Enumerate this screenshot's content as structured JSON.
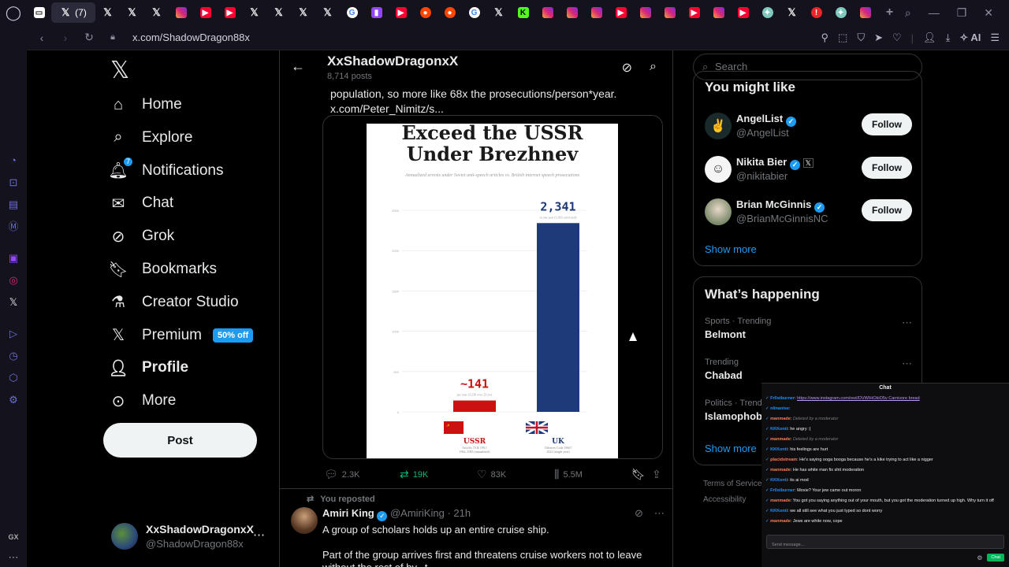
{
  "browser": {
    "active_tab_label": "(7)",
    "tabs": [
      "x",
      "x",
      "x",
      "ig",
      "yt",
      "yt",
      "x",
      "x",
      "x",
      "x",
      "gg",
      "tw",
      "yt",
      "rd",
      "rd",
      "gg",
      "x",
      "kk",
      "ig",
      "ig",
      "ig",
      "yt",
      "ig",
      "ig",
      "yt",
      "ig",
      "yt",
      "cf",
      "x",
      "rd2",
      "cf",
      "ig"
    ],
    "url": "x.com/ShadowDragon88x",
    "ai_label": "AI",
    "sidebar_bottom_label": "GX"
  },
  "nav": {
    "items": [
      {
        "label": "Home",
        "icon": "home-icon"
      },
      {
        "label": "Explore",
        "icon": "search-icon"
      },
      {
        "label": "Notifications",
        "icon": "bell-icon",
        "badge": "7"
      },
      {
        "label": "Chat",
        "icon": "mail-icon"
      },
      {
        "label": "Grok",
        "icon": "grok-icon"
      },
      {
        "label": "Bookmarks",
        "icon": "bookmark-icon"
      },
      {
        "label": "Creator Studio",
        "icon": "flask-icon"
      },
      {
        "label": "Premium",
        "icon": "x-icon",
        "badge": "50% off"
      },
      {
        "label": "Profile",
        "icon": "person-icon"
      },
      {
        "label": "More",
        "icon": "more-circle-icon"
      }
    ],
    "post_label": "Post",
    "account": {
      "name": "XxShadowDragonxX",
      "handle": "@ShadowDragon88x"
    }
  },
  "profile_header": {
    "name": "XxShadowDragonxX",
    "posts": "8,714 posts"
  },
  "tweet1": {
    "text_line1": "population, so more like 68x the prosecutions/person*year.",
    "text_line2": "x.com/Peter_Nimitz/s...",
    "chart_title_line1": "Exceed the USSR",
    "chart_title_line2": "Under Brezhnev",
    "chart_subtitle": "Annualized arrests under Soviet anti-speech articles vs. British internet speech prosecutions",
    "stats": {
      "replies": "2.3K",
      "reposts": "19K",
      "likes": "83K",
      "views": "5.5M"
    }
  },
  "chart_data": {
    "type": "bar",
    "title": "Exceed the USSR Under Brezhnev",
    "subtitle": "Annualized arrests under Soviet anti-speech articles vs. British internet speech prosecutions",
    "categories": [
      "USSR",
      "UK"
    ],
    "values": [
      141,
      2341
    ],
    "value_labels": [
      "~141",
      "2,341"
    ],
    "value_captions": [
      "per year (3,238 over 23 yrs)",
      "in one year (1,016 convicted)"
    ],
    "category_captions": [
      [
        "Articles 70 & 190.1",
        "1962–1985 (annualized)"
      ],
      [
        "Offences Code 19667",
        "2022 (single year)"
      ]
    ],
    "yticks": [
      0,
      500,
      1000,
      1500,
      2000,
      2500
    ],
    "ylim": [
      0,
      2500
    ],
    "colors": [
      "#cc1111",
      "#1f3a78"
    ],
    "grid": true
  },
  "tweet2": {
    "repost_label": "You reposted",
    "name": "Amiri King",
    "handle": "@AmiriKing",
    "time": "21h",
    "text1": "A group of scholars holds up an entire cruise ship.",
    "text2": "Part of the group arrives first and threatens cruise workers not to leave",
    "text3": "without the rest of by...t..."
  },
  "right": {
    "search_placeholder": "Search",
    "wtf_title": "You might like",
    "wtf": [
      {
        "name": "AngelList",
        "handle": "@AngelList",
        "follow": "Follow"
      },
      {
        "name": "Nikita Bier",
        "handle": "@nikitabier",
        "follow": "Follow"
      },
      {
        "name": "Brian McGinnis",
        "handle": "@BrianMcGinnisNC",
        "follow": "Follow"
      }
    ],
    "show_more": "Show more",
    "happening_title": "What’s happening",
    "trends": [
      {
        "category": "Sports · Trending",
        "name": "Belmont"
      },
      {
        "category": "Trending",
        "name": "Chabad"
      },
      {
        "category": "Politics · Trend",
        "name": "Islamophobi"
      }
    ],
    "show_more2": "Show more",
    "footer1": "Terms of Service",
    "footer2": "Accessibility"
  },
  "chat": {
    "title": "Chat",
    "messages": [
      {
        "user": "Fr0stburner",
        "color": "#1e90ff",
        "text": "https://www.instagram.com/reel/DVWIHOkiO5v Carnivore bread",
        "link": true
      },
      {
        "user": "nlinanise",
        "color": "#1e90ff",
        "text": ""
      },
      {
        "user": "manmade",
        "color": "#ff7f50",
        "text": "Deleted by a moderator",
        "deleted": true
      },
      {
        "user": "KKKonti",
        "color": "#1e90ff",
        "text": "he angry :("
      },
      {
        "user": "manmade",
        "color": "#ff7f50",
        "text": "Deleted by a moderator",
        "deleted": true
      },
      {
        "user": "KKKonti",
        "color": "#1e90ff",
        "text": "his feelings are hurt"
      },
      {
        "user": "placidstream",
        "color": "#ff7f50",
        "text": "He's saying ooga booga because he's a kike trying to act like a nigger"
      },
      {
        "user": "manmade",
        "color": "#ff7f50",
        "text": "He has white man fix shit moderation"
      },
      {
        "user": "KKKonti",
        "color": "#1e90ff",
        "text": "its ai mod"
      },
      {
        "user": "Fr0stburner",
        "color": "#1e90ff",
        "text": "Moxie? Your jew came out moron"
      },
      {
        "user": "manmade",
        "color": "#ff7f50",
        "text": "You got you saying anything out of your mouth, but you got the moderation turned up high. Why turn it off"
      },
      {
        "user": "KKKonti",
        "color": "#1e90ff",
        "text": "we all still see what you just typed so dont worry"
      },
      {
        "user": "manmade",
        "color": "#ff7f50",
        "text": "Jews are white now, cope"
      }
    ],
    "input_placeholder": "Send message...",
    "send_label": "Chat"
  }
}
